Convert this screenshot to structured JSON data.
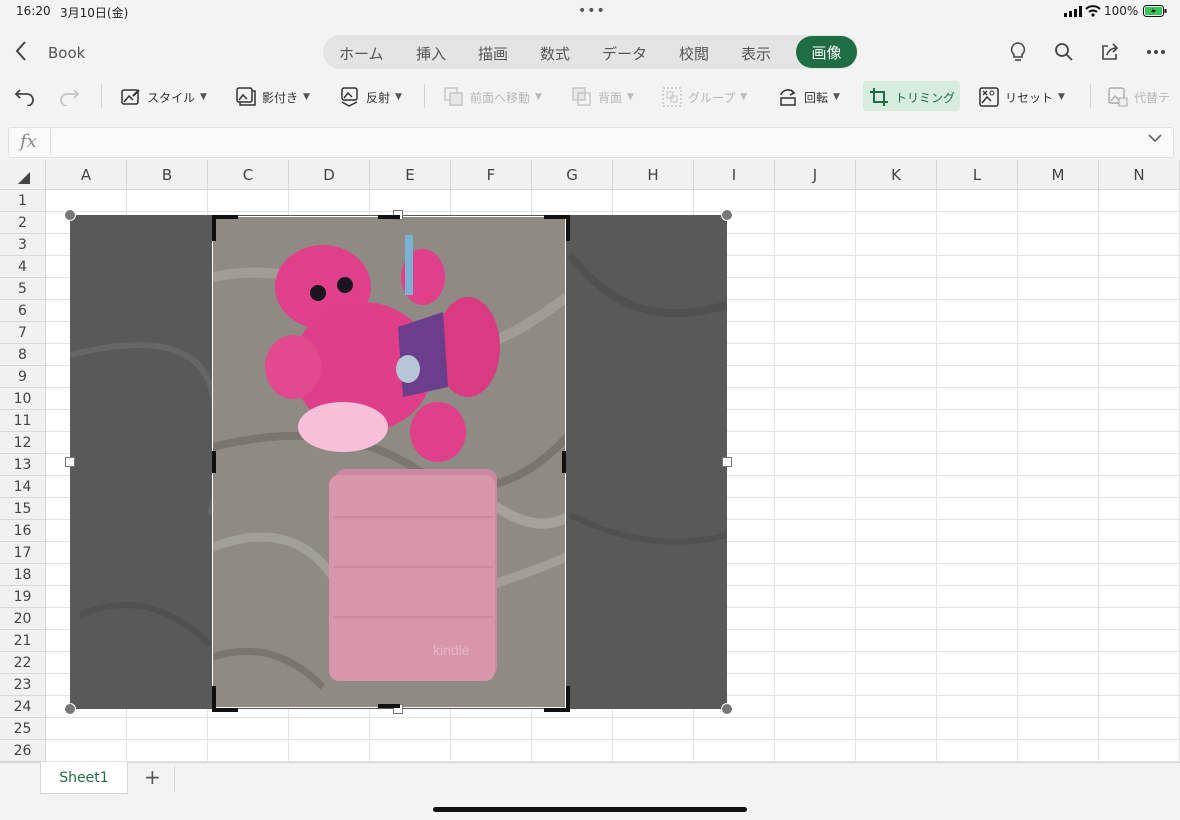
{
  "status": {
    "time": "16:20",
    "date": "3月10日(金)",
    "battery": "100%"
  },
  "header": {
    "title": "Book",
    "tabs": [
      "ホーム",
      "挿入",
      "描画",
      "数式",
      "データ",
      "校閲",
      "表示"
    ],
    "active_tab": "画像"
  },
  "ribbon": {
    "style": "スタイル",
    "shadow": "影付き",
    "reflect": "反射",
    "bring_forward": "前面へ移動",
    "send_back": "背面",
    "group": "グループ",
    "rotate": "回転",
    "crop": "トリミング",
    "reset": "リセット",
    "alt_text": "代替テ"
  },
  "formula": {
    "fx": "fx"
  },
  "grid": {
    "columns": [
      "A",
      "B",
      "C",
      "D",
      "E",
      "F",
      "G",
      "H",
      "I",
      "J",
      "K",
      "L",
      "M",
      "N"
    ],
    "rows": [
      "1",
      "2",
      "3",
      "4",
      "5",
      "6",
      "7",
      "8",
      "9",
      "10",
      "11",
      "12",
      "13",
      "14",
      "15",
      "16",
      "17",
      "18",
      "19",
      "20",
      "21",
      "22",
      "23",
      "24",
      "25",
      "26"
    ]
  },
  "image": {
    "kindle_text": "kindle"
  },
  "sheets": {
    "tabs": [
      "Sheet1"
    ],
    "add": "+"
  },
  "colors": {
    "accent": "#1f6e43",
    "crop_highlight": "#d6ecde"
  }
}
